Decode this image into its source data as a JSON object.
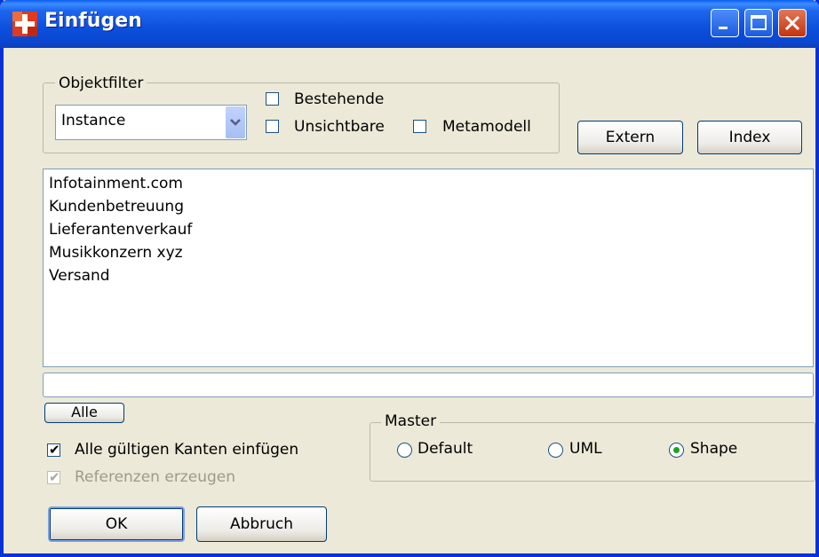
{
  "window": {
    "title": "Einfügen"
  },
  "object_filter": {
    "legend": "Objektfilter",
    "combo_value": "Instance",
    "checkbox_existing": {
      "label": "Bestehende",
      "checked": false
    },
    "checkbox_invisible": {
      "label": "Unsichtbare",
      "checked": false
    },
    "checkbox_metamodel": {
      "label": "Metamodell",
      "checked": false
    }
  },
  "buttons": {
    "extern": "Extern",
    "index": "Index",
    "all": "Alle",
    "ok": "OK",
    "cancel": "Abbruch"
  },
  "objects": [
    "Infotainment.com",
    "Kundenbetreuung",
    "Lieferantenverkauf",
    "Musikkonzern xyz",
    "Versand"
  ],
  "edit_value": "",
  "options": {
    "insert_edges": {
      "label": "Alle gültigen Kanten einfügen",
      "checked": true
    },
    "create_refs": {
      "label": "Referenzen erzeugen",
      "checked": true,
      "disabled": true
    }
  },
  "master": {
    "legend": "Master",
    "options": [
      {
        "label": "Default",
        "selected": false
      },
      {
        "label": "UML",
        "selected": false
      },
      {
        "label": "Shape",
        "selected": true
      }
    ]
  }
}
